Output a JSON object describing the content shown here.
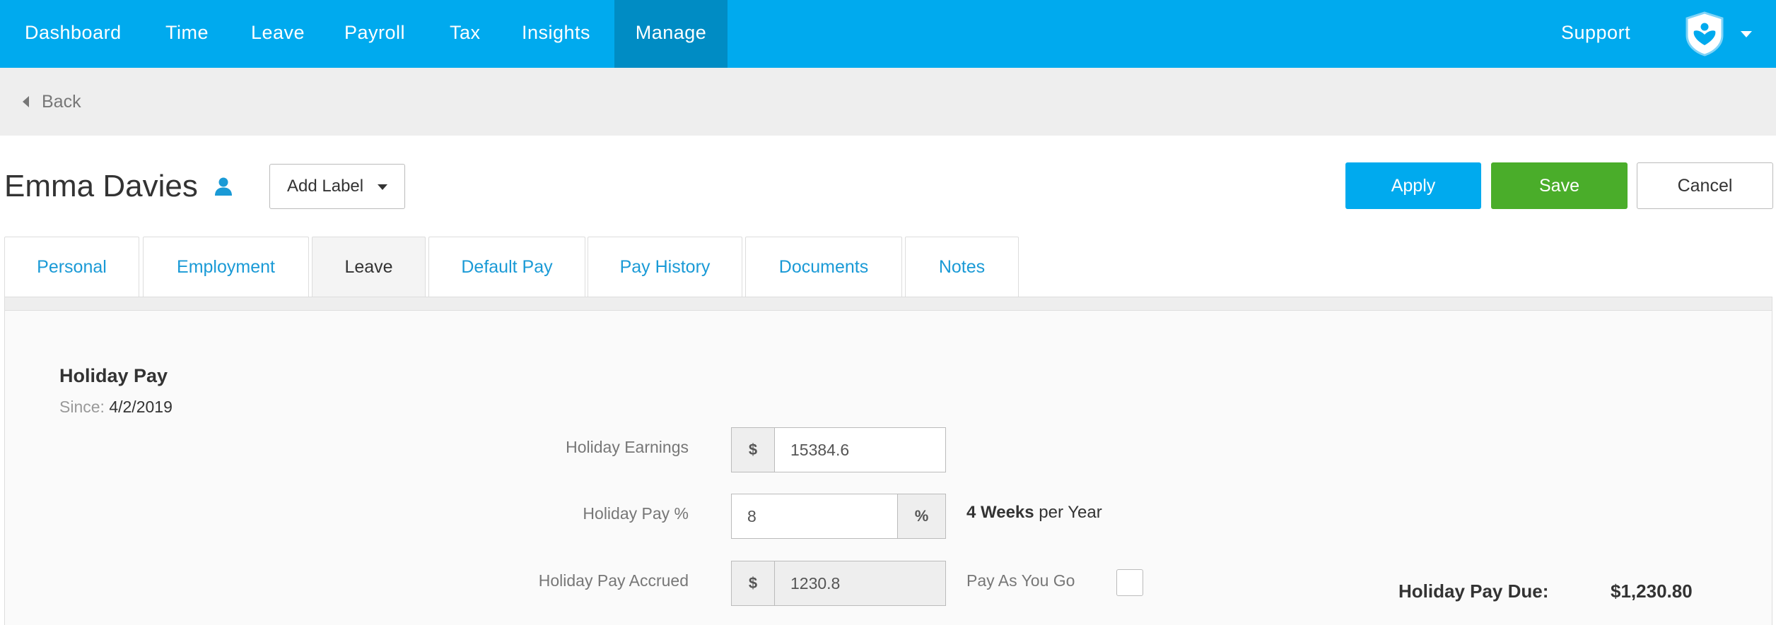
{
  "nav": {
    "items": [
      {
        "label": "Dashboard"
      },
      {
        "label": "Time"
      },
      {
        "label": "Leave"
      },
      {
        "label": "Payroll"
      },
      {
        "label": "Tax"
      },
      {
        "label": "Insights"
      },
      {
        "label": "Manage",
        "active": true
      }
    ],
    "support_label": "Support",
    "brand_color": "#00aaee",
    "active_color": "#008cc4",
    "account_icon": "shield-heart-icon"
  },
  "back": {
    "label": "Back"
  },
  "employee": {
    "name": "Emma Davies",
    "add_label": "Add Label"
  },
  "actions": {
    "apply": "Apply",
    "save": "Save",
    "cancel": "Cancel",
    "apply_color": "#00aaee",
    "save_color": "#4aad2a"
  },
  "tabs": [
    {
      "label": "Personal"
    },
    {
      "label": "Employment"
    },
    {
      "label": "Leave",
      "active": true
    },
    {
      "label": "Default Pay"
    },
    {
      "label": "Pay History"
    },
    {
      "label": "Documents"
    },
    {
      "label": "Notes"
    }
  ],
  "holiday": {
    "title": "Holiday Pay",
    "since_label": "Since:",
    "since_value": "4/2/2019",
    "earnings_label": "Holiday Earnings",
    "earnings_prefix": "$",
    "earnings_value": "15384.6",
    "pct_label": "Holiday Pay %",
    "pct_value": "8",
    "pct_suffix": "%",
    "weeks_bold": "4 Weeks",
    "weeks_rest": "per Year",
    "accrued_label": "Holiday Pay Accrued",
    "accrued_prefix": "$",
    "accrued_value": "1230.8",
    "payg_label": "Pay As You Go",
    "payg_checked": false,
    "due_label": "Holiday Pay Due:",
    "due_value": "$1,230.80"
  }
}
